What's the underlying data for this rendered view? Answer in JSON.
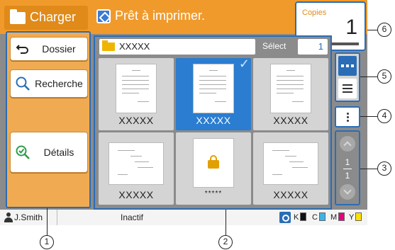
{
  "header": {
    "section_label": "Charger",
    "status": "Prêt à imprimer."
  },
  "copies": {
    "label": "Copies",
    "value": "1"
  },
  "left_panel": {
    "dossier_label": "Dossier",
    "recherche_label": "Recherche",
    "details_label": "Détails"
  },
  "file_list": {
    "folder_name": "XXXXX",
    "select_label": "Sélect",
    "select_count": "1",
    "items": [
      {
        "name": "XXXXX",
        "selected": false,
        "locked": false
      },
      {
        "name": "XXXXX",
        "selected": true,
        "locked": false
      },
      {
        "name": "XXXXX",
        "selected": false,
        "locked": false
      },
      {
        "name": "XXXXX",
        "selected": false,
        "locked": false
      },
      {
        "name": "*****",
        "selected": false,
        "locked": true
      },
      {
        "name": "XXXXX",
        "selected": false,
        "locked": false
      }
    ]
  },
  "pager": {
    "current": "1",
    "total": "1"
  },
  "status_bar": {
    "user": "J.Smith",
    "state": "Inactif",
    "inks": [
      "K",
      "C",
      "M",
      "Y"
    ]
  },
  "colors": {
    "accent": "#f09a2c",
    "selection": "#2a7dd0",
    "ink_k": "#111111",
    "ink_c": "#3cb4e6",
    "ink_m": "#e6007e",
    "ink_y": "#ffe100"
  },
  "callouts": [
    "1",
    "2",
    "3",
    "4",
    "5",
    "6"
  ]
}
